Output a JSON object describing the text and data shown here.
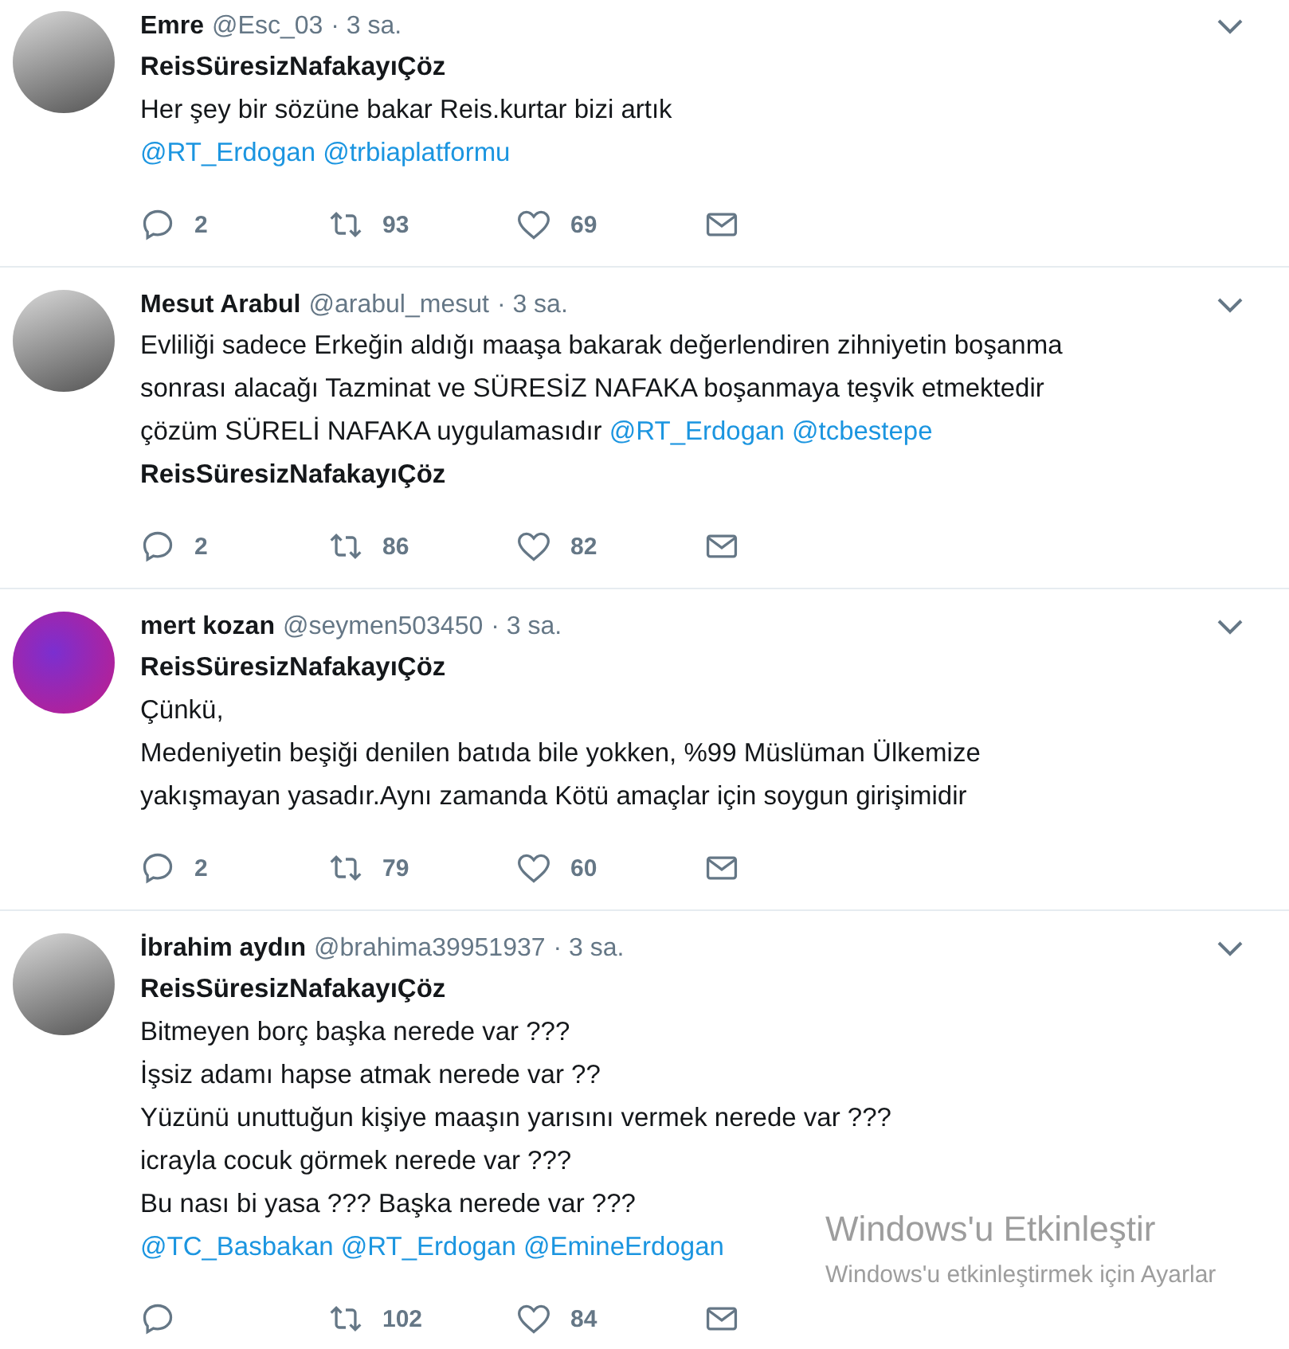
{
  "tweets": [
    {
      "name": "Emre",
      "handle": "@Esc_03",
      "time": "· 3 sa.",
      "avatar": {
        "kind": "photo"
      },
      "lines": [
        [
          {
            "kind": "hashtag",
            "text": "ReisSüresizNafakayıÇöz"
          }
        ],
        [
          {
            "kind": "text",
            "text": "Her şey bir sözüne bakar Reis.kurtar bizi artık"
          }
        ],
        [
          {
            "kind": "mention",
            "text": "@RT_Erdogan"
          },
          {
            "kind": "mention",
            "text": "@trbiaplatformu"
          }
        ]
      ],
      "replies": "2",
      "retweets": "93",
      "likes": "69"
    },
    {
      "name": "Mesut Arabul",
      "handle": "@arabul_mesut",
      "time": "· 3 sa.",
      "avatar": {
        "kind": "photo"
      },
      "lines": [
        [
          {
            "kind": "text",
            "text": "Evliliği sadece Erkeğin aldığı maaşa bakarak değerlendiren zihniyetin boşanma"
          }
        ],
        [
          {
            "kind": "text",
            "text": "sonrası alacağı Tazminat ve SÜRESİZ NAFAKA boşanmaya teşvik etmektedir"
          }
        ],
        [
          {
            "kind": "text",
            "text": "çözüm SÜRELİ NAFAKA uygulamasıdır"
          },
          {
            "kind": "mention",
            "text": "@RT_Erdogan"
          },
          {
            "kind": "mention",
            "text": "@tcbestepe"
          }
        ],
        [
          {
            "kind": "hashtag",
            "text": "ReisSüresizNafakayıÇöz"
          }
        ]
      ],
      "replies": "2",
      "retweets": "86",
      "likes": "82"
    },
    {
      "name": "mert kozan",
      "handle": "@seymen503450",
      "time": "· 3 sa.",
      "avatar": {
        "kind": "graphic"
      },
      "lines": [
        [
          {
            "kind": "hashtag",
            "text": "ReisSüresizNafakayıÇöz"
          }
        ],
        [
          {
            "kind": "text",
            "text": "Çünkü,"
          }
        ],
        [
          {
            "kind": "text",
            "text": "Medeniyetin beşiği denilen batıda bile yokken, %99 Müslüman  Ülkemize"
          }
        ],
        [
          {
            "kind": "text",
            "text": "yakışmayan yasadır.Aynı zamanda Kötü amaçlar için soygun girişimidir"
          }
        ]
      ],
      "replies": "2",
      "retweets": "79",
      "likes": "60"
    },
    {
      "name": "İbrahim aydın",
      "handle": "@brahima39951937",
      "time": "· 3 sa.",
      "avatar": {
        "kind": "photo"
      },
      "lines": [
        [
          {
            "kind": "hashtag",
            "text": "ReisSüresizNafakayıÇöz"
          }
        ],
        [
          {
            "kind": "text",
            "text": "Bitmeyen borç başka nerede var ???"
          }
        ],
        [
          {
            "kind": "text",
            "text": "İşsiz adamı hapse atmak nerede var ??"
          }
        ],
        [
          {
            "kind": "text",
            "text": "Yüzünü unuttuğun kişiye maaşın yarısını vermek nerede var ???"
          }
        ],
        [
          {
            "kind": "text",
            "text": "icrayla cocuk görmek nerede var ???"
          }
        ],
        [
          {
            "kind": "text",
            "text": "Bu nası bi yasa ??? Başka nerede var ???"
          }
        ],
        [
          {
            "kind": "mention",
            "text": "@TC_Basbakan"
          },
          {
            "kind": "mention",
            "text": "@RT_Erdogan"
          },
          {
            "kind": "mention",
            "text": "@EmineErdogan"
          }
        ]
      ],
      "retweets": "102",
      "likes": "84"
    }
  ],
  "activation": {
    "title": "Windows'u Etkinleştir",
    "subtitle": "Windows'u etkinleştirmek için Ayarlar"
  }
}
